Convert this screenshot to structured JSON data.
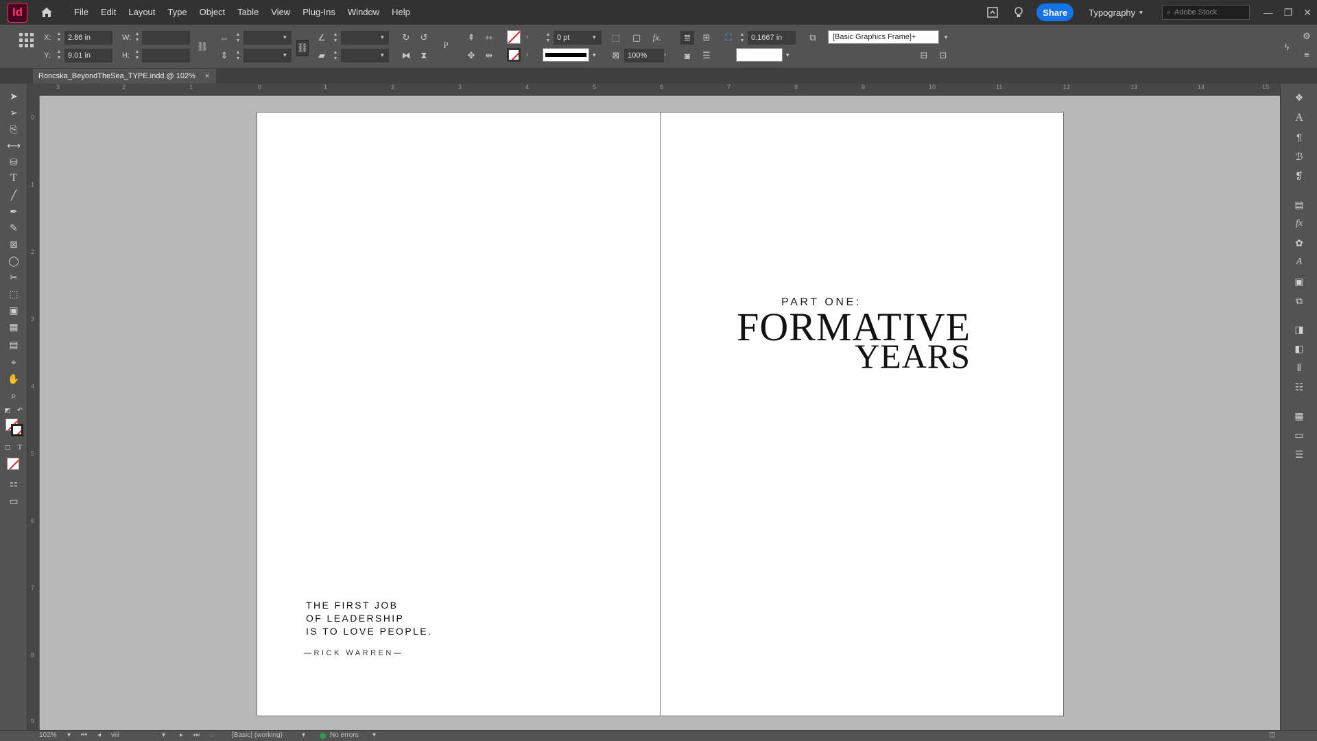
{
  "app": {
    "logo": "Id",
    "menu": [
      "File",
      "Edit",
      "Layout",
      "Type",
      "Object",
      "Table",
      "View",
      "Plug-Ins",
      "Window",
      "Help"
    ],
    "share_label": "Share",
    "workspace": "Typography",
    "stock_placeholder": "Adobe Stock"
  },
  "control": {
    "x_label": "X:",
    "x_value": "2.86 in",
    "y_label": "Y:",
    "y_value": "9.01 in",
    "w_label": "W:",
    "h_label": "H:",
    "stroke_weight": "0 pt",
    "opacity": "100%",
    "fx_label": "fx.",
    "inset_value": "0.1667 in",
    "object_style": "[Basic Graphics Frame]+"
  },
  "document": {
    "tab_title": "Roncska_BeyondTheSea_TYPE.indd @ 102%",
    "close_glyph": "×"
  },
  "rulers": {
    "top": [
      "3",
      "2",
      "1",
      "0",
      "1",
      "2",
      "3",
      "4",
      "5",
      "6",
      "7",
      "8",
      "9",
      "10",
      "11",
      "12",
      "13",
      "14",
      "15"
    ],
    "left": [
      "0",
      "1",
      "2",
      "3",
      "4",
      "5",
      "6",
      "7",
      "8",
      "9"
    ]
  },
  "spread": {
    "quote_lines": [
      "THE FIRST JOB",
      "OF LEADERSHIP",
      "IS TO LOVE PEOPLE."
    ],
    "attribution": "—RICK WARREN—",
    "part_label": "PART ONE:",
    "title_line1": "FORMATIVE",
    "title_line2": "YEARS"
  },
  "status": {
    "zoom": "102%",
    "page": "viii",
    "preflight_profile": "[Basic] (working)",
    "errors": "No errors"
  },
  "colors": {
    "accent": "#1473e6",
    "app_brand": "#ff3366",
    "ok": "#2d9d4a"
  }
}
